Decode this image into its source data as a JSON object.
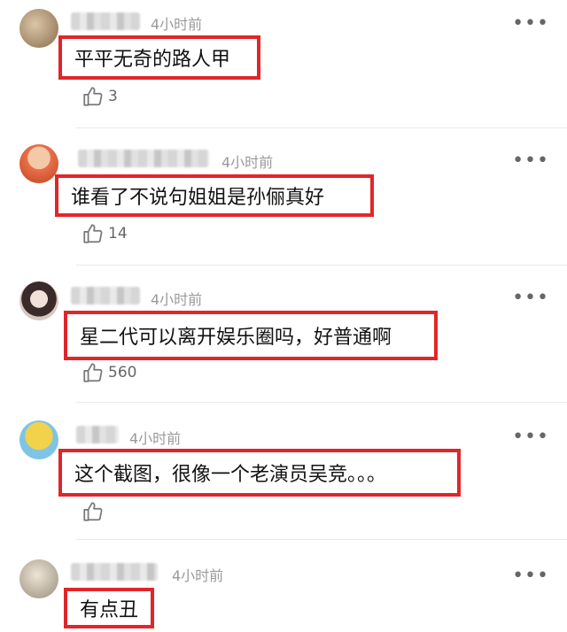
{
  "comments": [
    {
      "time": "4小时前",
      "text": "平平无奇的路人甲",
      "likes": "3",
      "colors": [
        "#c9b59a",
        "#8a6b4c"
      ]
    },
    {
      "time": "4小时前",
      "text": "谁看了不说句姐姐是孙俪真好",
      "likes": "14",
      "colors": [
        "#e9704a",
        "#c04422"
      ]
    },
    {
      "time": "4小时前",
      "text": "星二代可以离开娱乐圈吗，好普通啊",
      "likes": "560",
      "colors": [
        "#e8d8d0",
        "#3a2a2a"
      ]
    },
    {
      "time": "4小时前",
      "text": "这个截图，很像一个老演员吴竞。。。",
      "likes": "",
      "colors": [
        "#f2d24a",
        "#7fc4e6"
      ]
    },
    {
      "time": "4小时前",
      "text": "有点丑",
      "likes": "",
      "colors": [
        "#d6cfc2",
        "#9a8e7c"
      ]
    }
  ],
  "more_glyph": "•••",
  "thumb_icon": "thumbs-up-icon"
}
